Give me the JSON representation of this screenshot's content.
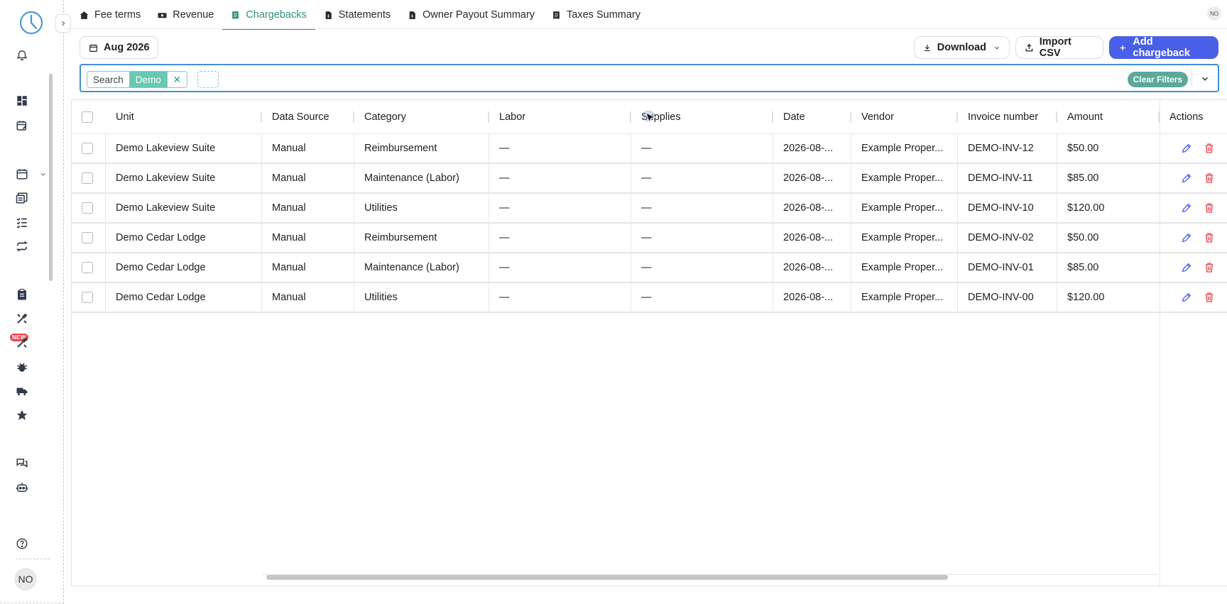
{
  "tabs": [
    {
      "label": "Fee terms",
      "icon": "house-dollar-icon"
    },
    {
      "label": "Revenue",
      "icon": "money-bill-icon"
    },
    {
      "label": "Chargebacks",
      "icon": "receipt-icon",
      "active": true
    },
    {
      "label": "Statements",
      "icon": "file-dollar-icon"
    },
    {
      "label": "Owner Payout Summary",
      "icon": "file-dollar-icon"
    },
    {
      "label": "Taxes Summary",
      "icon": "receipt-icon"
    }
  ],
  "user": {
    "initials": "NO"
  },
  "sidebar": {
    "new_badge": "NEW"
  },
  "toolbar": {
    "month": "Aug 2026",
    "download": "Download",
    "import_csv": "Import CSV",
    "add_chargeback": "Add chargeback"
  },
  "filter": {
    "field": "Search",
    "value": "Demo",
    "clear": "Clear Filters"
  },
  "table": {
    "columns": [
      "Unit",
      "Data Source",
      "Category",
      "Labor",
      "Supplies",
      "Date",
      "Vendor",
      "Invoice number",
      "Amount",
      "Actions"
    ],
    "rows": [
      [
        "Demo Lakeview Suite",
        "Manual",
        "Reimbursement",
        "—",
        "—",
        "2026-08-...",
        "Example Proper...",
        "DEMO-INV-12",
        "$50.00"
      ],
      [
        "Demo Lakeview Suite",
        "Manual",
        "Maintenance (Labor)",
        "—",
        "—",
        "2026-08-...",
        "Example Proper...",
        "DEMO-INV-11",
        "$85.00"
      ],
      [
        "Demo Lakeview Suite",
        "Manual",
        "Utilities",
        "—",
        "—",
        "2026-08-...",
        "Example Proper...",
        "DEMO-INV-10",
        "$120.00"
      ],
      [
        "Demo Cedar Lodge",
        "Manual",
        "Reimbursement",
        "—",
        "—",
        "2026-08-...",
        "Example Proper...",
        "DEMO-INV-02",
        "$50.00"
      ],
      [
        "Demo Cedar Lodge",
        "Manual",
        "Maintenance (Labor)",
        "—",
        "—",
        "2026-08-...",
        "Example Proper...",
        "DEMO-INV-01",
        "$85.00"
      ],
      [
        "Demo Cedar Lodge",
        "Manual",
        "Utilities",
        "—",
        "—",
        "2026-08-...",
        "Example Proper...",
        "DEMO-INV-00",
        "$120.00"
      ]
    ]
  },
  "colors": {
    "accent": "#2f8f7b",
    "primary": "#4a5fe8",
    "danger": "#e5484d",
    "filter_border": "#3f8fd8"
  }
}
